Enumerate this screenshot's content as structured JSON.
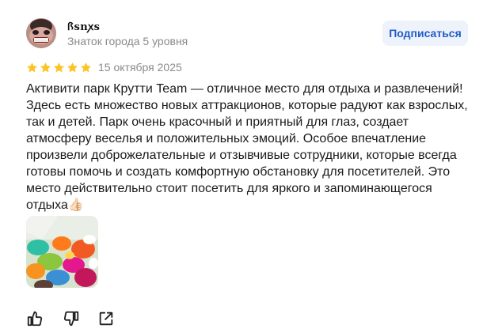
{
  "author": {
    "name": "ꟗsnꭗs",
    "level": "Знаток города 5 уровня"
  },
  "subscribe_label": "Подписаться",
  "rating": {
    "value": 5,
    "max": 5,
    "star_color": "#fcc421"
  },
  "review": {
    "date": "15 октября 2025",
    "text": "Активити парк Крутти Team — отличное место для отдыха и развлечений!\nЗдесь есть множество новых аттракционов, которые радуют как взрослых,\nтак и детей. Парк очень красочный и приятный для глаз, создает\nатмосферу веселья и положительных эмоций. Особое впечатление\nпроизвели доброжелательные и отзывчивые сотрудники, которые всегда\nготовы помочь и создать комфортную обстановку для посетителей. Это\nместо действительно стоит посетить для яркого и запоминающегося\nотдыха👍🏻"
  },
  "actions": {
    "like_icon": "thumbs-up-icon",
    "dislike_icon": "thumbs-down-icon",
    "share_icon": "share-icon"
  },
  "colors": {
    "accent": "#1f5cc9",
    "button_bg": "#eef2fb",
    "muted_text": "#8a8a8a"
  }
}
